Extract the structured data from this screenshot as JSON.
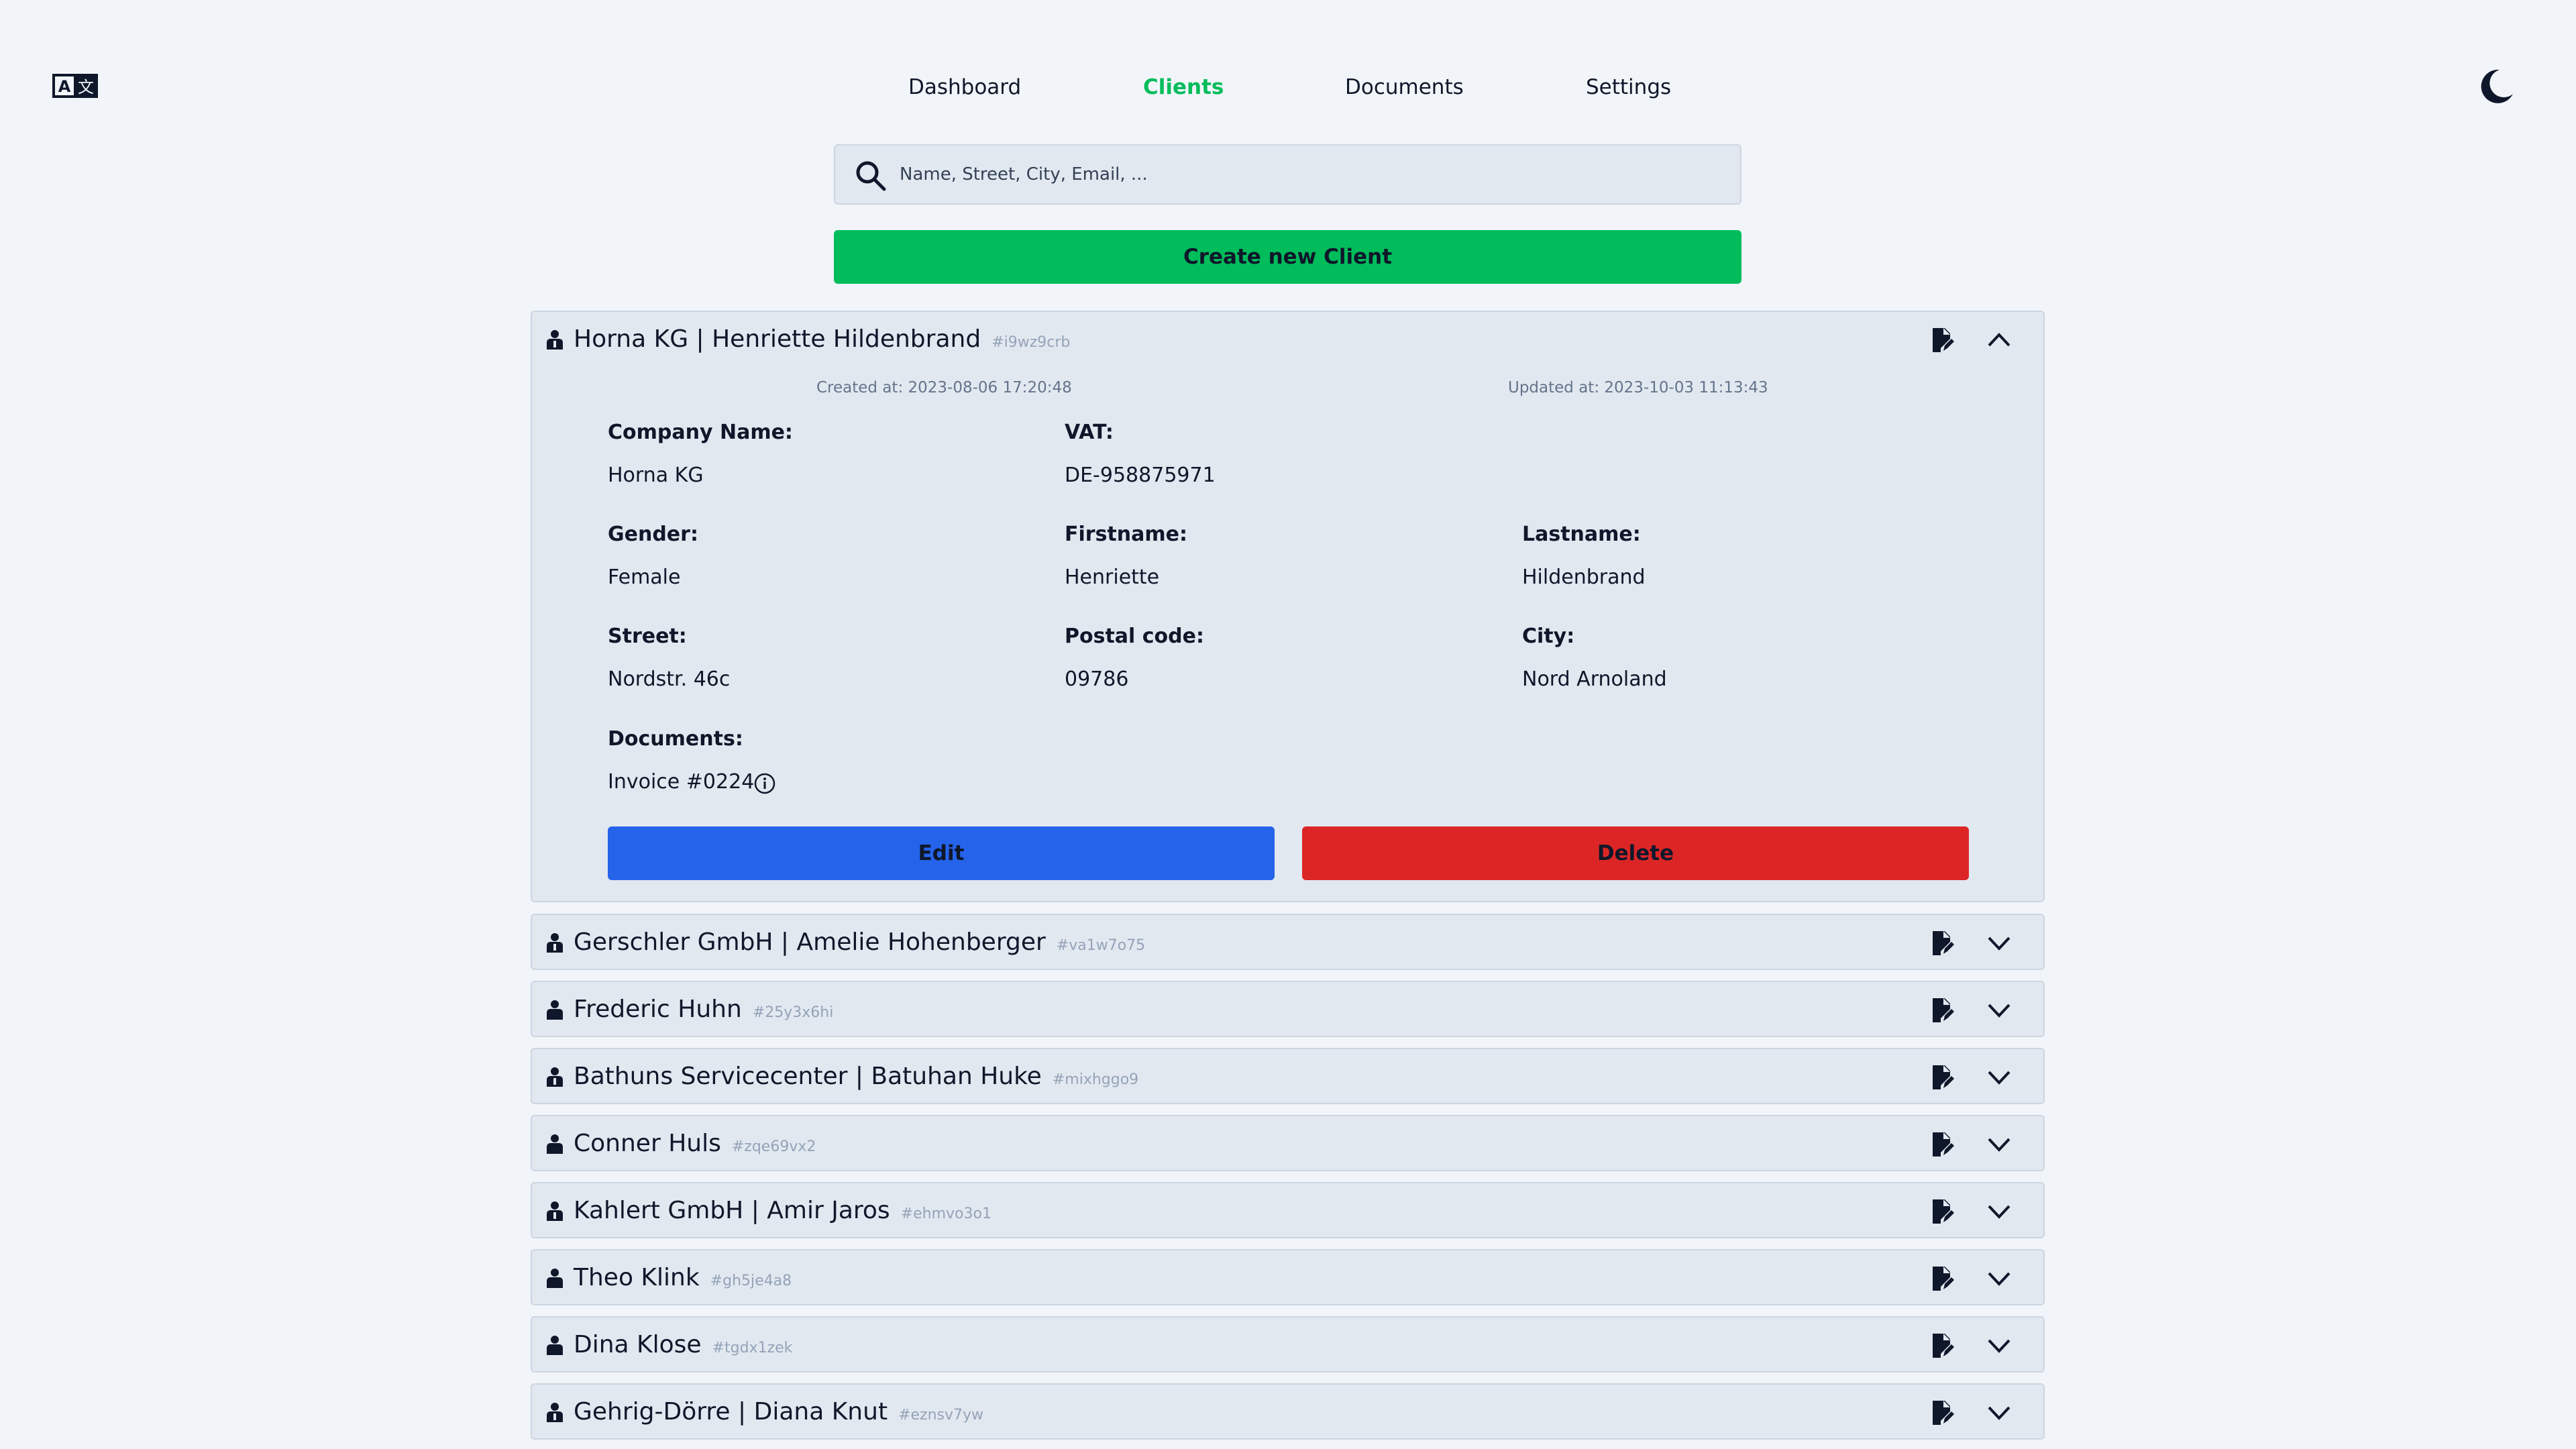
{
  "nav": {
    "items": [
      {
        "label": "Dashboard",
        "active": false
      },
      {
        "label": "Clients",
        "active": true
      },
      {
        "label": "Documents",
        "active": false
      },
      {
        "label": "Settings",
        "active": false
      }
    ]
  },
  "icons": {
    "language": "translate-icon",
    "theme": "moon-icon",
    "search": "search-icon",
    "client_company": "company-person-icon",
    "client_person": "person-icon",
    "edit_doc": "file-edit-icon",
    "expand": "chevron-down-icon",
    "collapse": "chevron-up-icon",
    "info": "info-icon"
  },
  "colors": {
    "accent": "#00bc5b",
    "edit": "#2563eb",
    "delete": "#dc2626",
    "background": "#f1f5f9",
    "card": "#e2e8f0"
  },
  "search": {
    "placeholder": "Name, Street, City, Email, ...",
    "value": ""
  },
  "create_button": "Create new Client",
  "expanded": {
    "name": "Horna KG | Henriette Hildenbrand",
    "id": "#i9wz9crb",
    "created": "Created at: 2023-08-06 17:20:48",
    "updated": "Updated at: 2023-10-03 11:13:43",
    "fields": {
      "company_label": "Company Name:",
      "company": "Horna KG",
      "vat_label": "VAT:",
      "vat": "DE-958875971",
      "gender_label": "Gender:",
      "gender": "Female",
      "firstname_label": "Firstname:",
      "firstname": "Henriette",
      "lastname_label": "Lastname:",
      "lastname": "Hildenbrand",
      "street_label": "Street:",
      "street": "Nordstr. 46c",
      "postal_label": "Postal code:",
      "postal": "09786",
      "city_label": "City:",
      "city": "Nord Arnoland",
      "documents_label": "Documents:",
      "document": "Invoice #0224"
    },
    "edit_label": "Edit",
    "delete_label": "Delete"
  },
  "clients": [
    {
      "name": "Gerschler GmbH | Amelie Hohenberger",
      "id": "#va1w7o75",
      "company": true
    },
    {
      "name": "Frederic Huhn",
      "id": "#25y3x6hi",
      "company": false
    },
    {
      "name": "Bathuns Servicecenter | Batuhan Huke",
      "id": "#mixhggo9",
      "company": true
    },
    {
      "name": "Conner Huls",
      "id": "#zqe69vx2",
      "company": false
    },
    {
      "name": "Kahlert GmbH | Amir Jaros",
      "id": "#ehmvo3o1",
      "company": true
    },
    {
      "name": "Theo Klink",
      "id": "#gh5je4a8",
      "company": false
    },
    {
      "name": "Dina Klose",
      "id": "#tgdx1zek",
      "company": false
    },
    {
      "name": "Gehrig-Dörre | Diana Knut",
      "id": "#eznsv7yw",
      "company": true
    }
  ]
}
